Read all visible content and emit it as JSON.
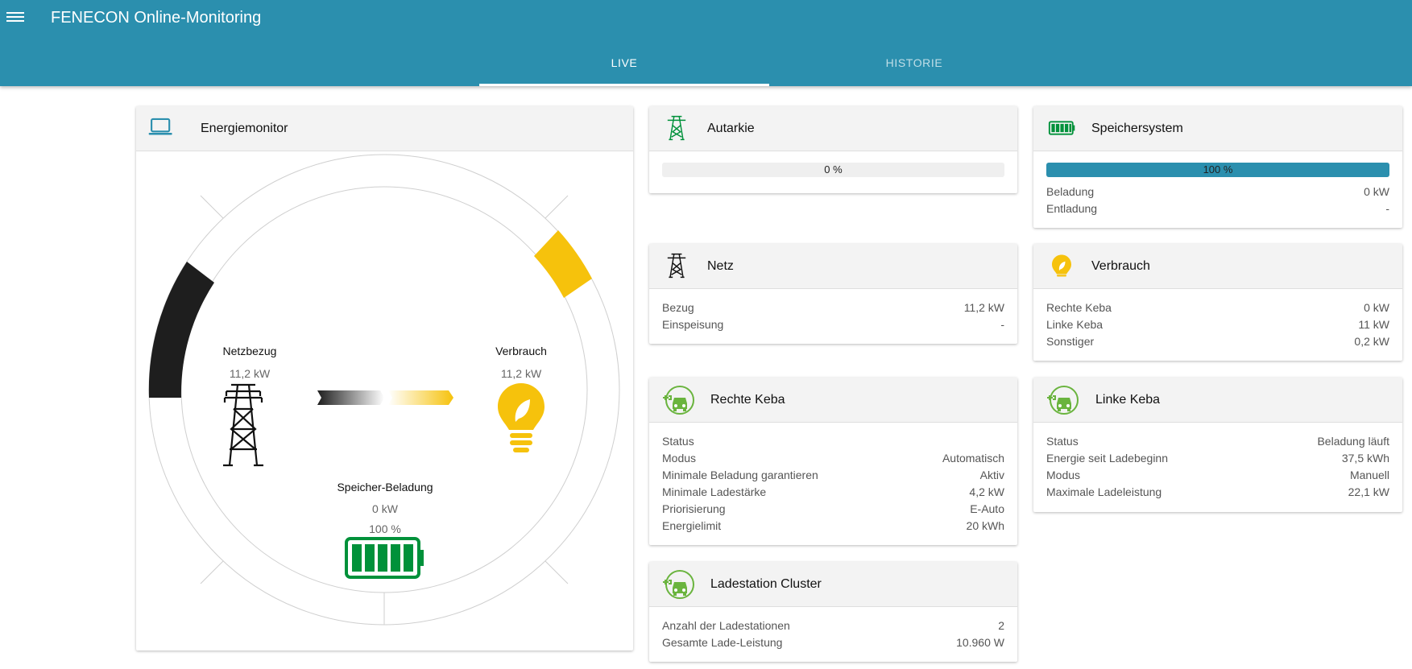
{
  "app": {
    "title": "FENECON Online-Monitoring"
  },
  "tabs": [
    {
      "label": "LIVE"
    },
    {
      "label": "HISTORIE"
    }
  ],
  "colors": {
    "primary": "#2b8fae",
    "green": "#00913a",
    "yellow": "#f6c20c",
    "dark": "#1e1e1e"
  },
  "energiemonitor": {
    "title": "Energiemonitor",
    "icon": "laptop-icon",
    "netzbezug": {
      "label": "Netzbezug",
      "value": "11,2 kW",
      "icon": "power-tower-icon"
    },
    "verbrauch": {
      "label": "Verbrauch",
      "value": "11,2 kW",
      "icon": "lightbulb-icon"
    },
    "speicher": {
      "label": "Speicher-Beladung",
      "value": "0 kW",
      "soc": "100 %",
      "icon": "battery-icon"
    }
  },
  "autarkie": {
    "title": "Autarkie",
    "icon": "power-tower-icon",
    "percent": 0,
    "percent_text": "0 %"
  },
  "speichersystem": {
    "title": "Speichersystem",
    "icon": "battery-icon",
    "percent": 100,
    "percent_text": "100 %",
    "rows": [
      {
        "label": "Beladung",
        "value": "0 kW"
      },
      {
        "label": "Entladung",
        "value": "-"
      }
    ]
  },
  "netz": {
    "title": "Netz",
    "icon": "power-tower-icon",
    "rows": [
      {
        "label": "Bezug",
        "value": "11,2 kW"
      },
      {
        "label": "Einspeisung",
        "value": "-"
      }
    ]
  },
  "verbrauch": {
    "title": "Verbrauch",
    "icon": "lightbulb-icon",
    "rows": [
      {
        "label": "Rechte Keba",
        "value": "0 kW"
      },
      {
        "label": "Linke Keba",
        "value": "11 kW"
      },
      {
        "label": "Sonstiger",
        "value": "0,2 kW"
      }
    ]
  },
  "rechte_keba": {
    "title": "Rechte Keba",
    "icon": "ev-charger-icon",
    "rows": [
      {
        "label": "Status",
        "value": ""
      },
      {
        "label": "Modus",
        "value": "Automatisch"
      },
      {
        "label": "Minimale Beladung garantieren",
        "value": "Aktiv"
      },
      {
        "label": "Minimale Ladestärke",
        "value": "4,2 kW"
      },
      {
        "label": "Priorisierung",
        "value": "E-Auto"
      },
      {
        "label": "Energielimit",
        "value": "20 kWh"
      }
    ]
  },
  "linke_keba": {
    "title": "Linke Keba",
    "icon": "ev-charger-icon",
    "rows": [
      {
        "label": "Status",
        "value": "Beladung läuft"
      },
      {
        "label": "Energie seit Ladebeginn",
        "value": "37,5 kWh"
      },
      {
        "label": "Modus",
        "value": "Manuell"
      },
      {
        "label": "Maximale Ladeleistung",
        "value": "22,1 kW"
      }
    ]
  },
  "ladestation_cluster": {
    "title": "Ladestation Cluster",
    "icon": "ev-charger-icon",
    "rows": [
      {
        "label": "Anzahl der Ladestationen",
        "value": "2"
      },
      {
        "label": "Gesamte Lade-Leistung",
        "value": "10.960 W"
      }
    ]
  }
}
